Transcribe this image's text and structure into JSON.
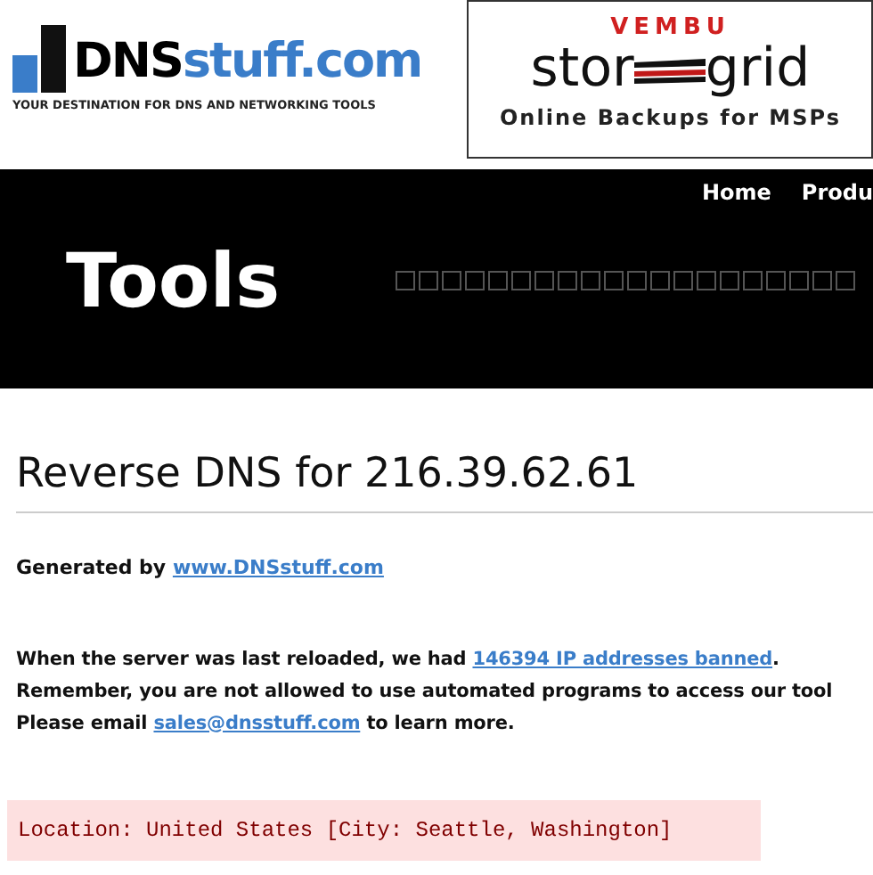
{
  "logo": {
    "name_dark": "DNS",
    "name_blue": "stuff.com",
    "tagline": "YOUR DESTINATION FOR DNS AND NETWORKING TOOLS"
  },
  "ad": {
    "brand": "VEMBU",
    "word_left": "stor",
    "word_right": "grid",
    "tagline": "Online Backups for MSPs"
  },
  "nav": [
    "Home",
    "Produ"
  ],
  "banner": {
    "title": "Tools"
  },
  "heading": "Reverse DNS for 216.39.62.61",
  "generated": {
    "label": "Generated by",
    "link": "www.DNSstuff.com"
  },
  "notice": [
    {
      "before": "When the server was last reloaded, we had ",
      "link": "146394 IP addresses banned",
      "after": "."
    },
    {
      "before": "Remember, you are not allowed to use automated programs to access our tool"
    },
    {
      "before": "Please email ",
      "link": "sales@dnsstuff.com",
      "after": " to learn more."
    }
  ],
  "location": "Location: United States [City: Seattle, Washington]"
}
